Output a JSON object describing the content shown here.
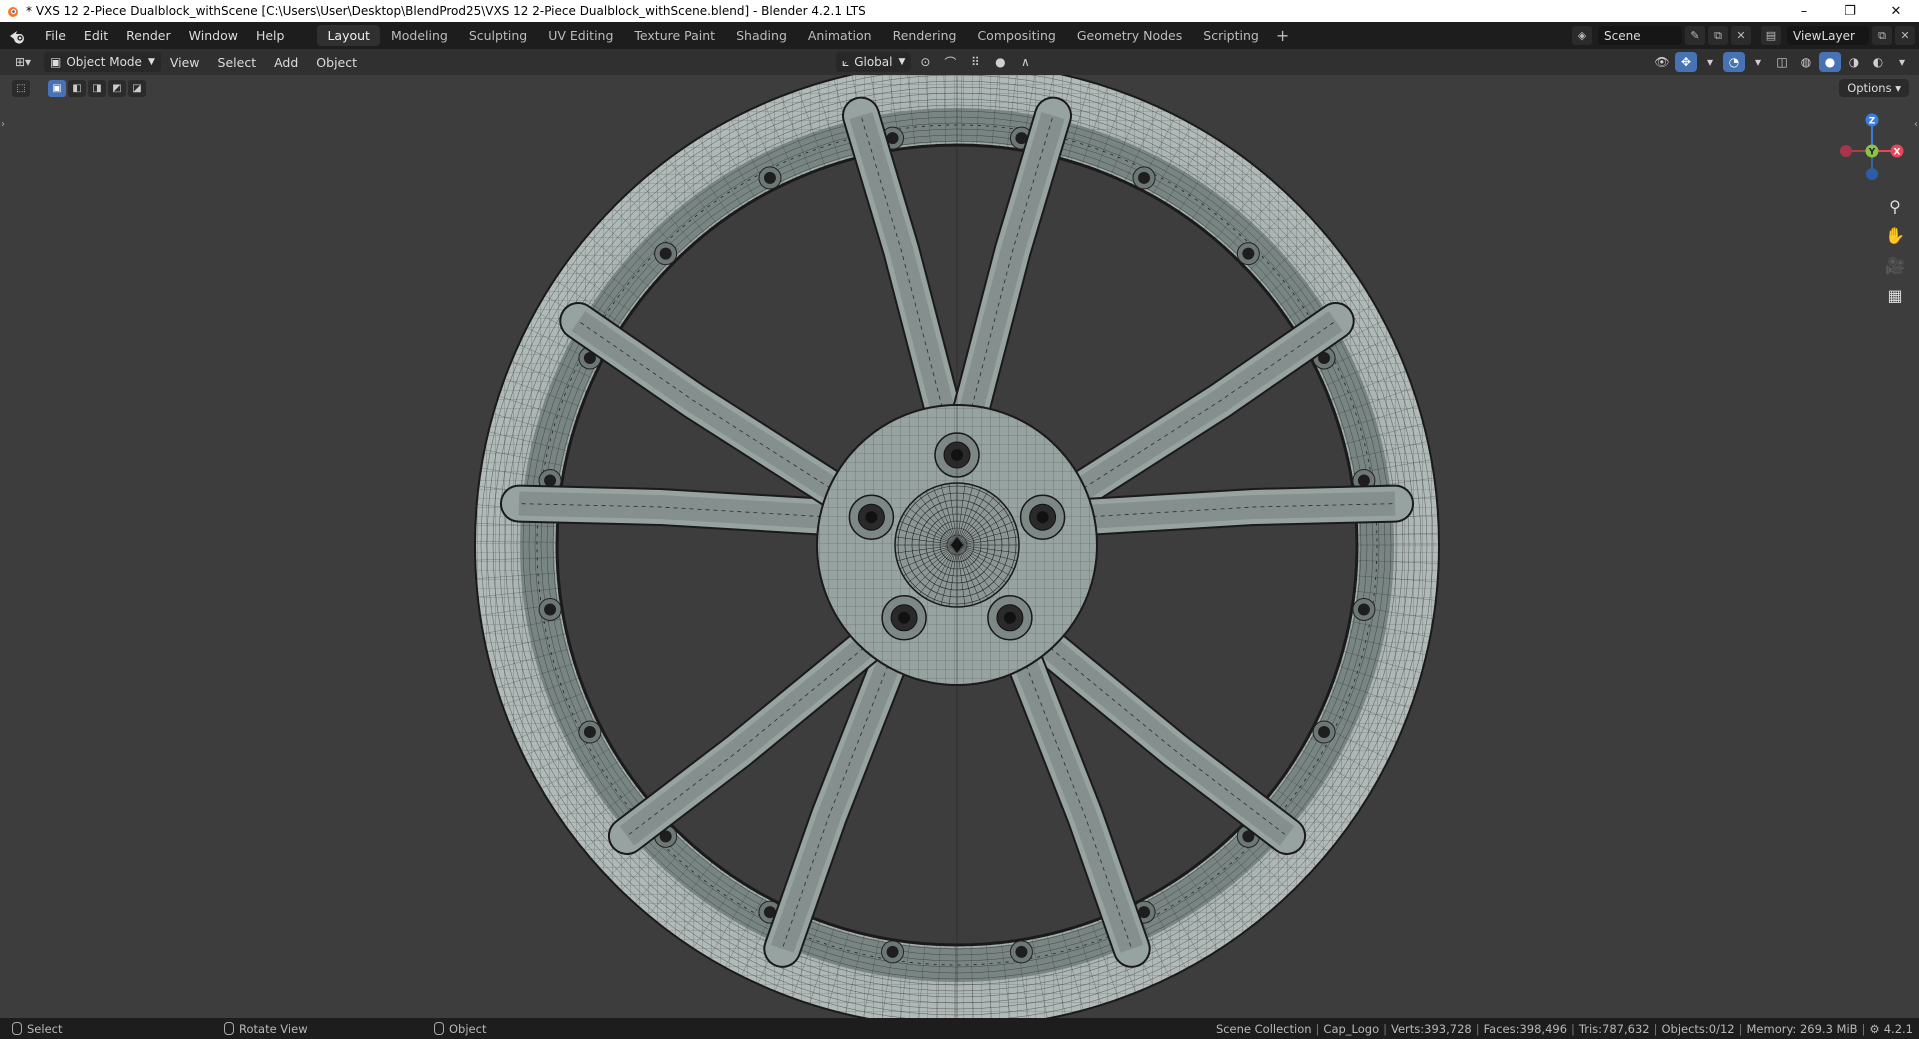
{
  "window": {
    "title": "* VXS 12 2-Piece Dualblock_withScene [C:\\Users\\User\\Desktop\\BlendProd25\\VXS 12 2-Piece Dualblock_withScene.blend] - Blender 4.2.1 LTS",
    "minimize": "–",
    "restore": "❐",
    "close": "✕"
  },
  "topbar": {
    "menus": [
      "File",
      "Edit",
      "Render",
      "Window",
      "Help"
    ],
    "workspaces": [
      "Layout",
      "Modeling",
      "Sculpting",
      "UV Editing",
      "Texture Paint",
      "Shading",
      "Animation",
      "Rendering",
      "Compositing",
      "Geometry Nodes",
      "Scripting"
    ],
    "active_workspace": "Layout",
    "add_workspace": "+",
    "scene_name": "Scene",
    "view_layer": "ViewLayer"
  },
  "viewport_header": {
    "mode": "Object Mode",
    "menus": [
      "View",
      "Select",
      "Add",
      "Object"
    ],
    "transform_orientation": "Global"
  },
  "viewport": {
    "options_label": "Options",
    "gizmo": {
      "z": "Z",
      "y": "Y",
      "x": "X"
    }
  },
  "status": {
    "left_select": "Select",
    "middle_rotate": "Rotate View",
    "right_object": "Object",
    "scene_collection": "Scene Collection",
    "active_object": "Cap_Logo",
    "verts": "Verts:393,728",
    "faces": "Faces:398,496",
    "tris": "Tris:787,632",
    "objects": "Objects:0/12",
    "memory": "Memory: 269.3 MiB",
    "version": "4.2.1"
  },
  "colors": {
    "accent": "#4772b3",
    "wheel_base": "#97a3a1",
    "axis_x": "#e8455a",
    "axis_y": "#8bc34a",
    "axis_z": "#3a7ddc"
  },
  "icons": [
    "blender-logo-icon",
    "editor-type-icon",
    "cursor-icon",
    "zoom-icon",
    "hand-icon",
    "camera-icon",
    "grid-icon"
  ]
}
